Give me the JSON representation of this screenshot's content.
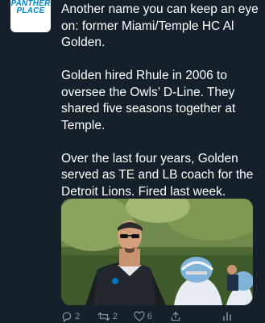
{
  "author": {
    "avatar_logo_text": "PANTHER PLACE"
  },
  "tweet": {
    "paragraphs": [
      "Another name you can keep an eye on: former Miami/Temple HC Al Golden.",
      "Golden hired Rhule in 2006 to oversee the Owls’ D-Line. They shared five seasons together at Temple.",
      "Over the last four years, Golden served as TE and LB coach for the Detroit Lions. Fired last week."
    ]
  },
  "actions": {
    "reply_count": "2",
    "retweet_count": "2",
    "like_count": "6"
  },
  "icons": {
    "reply": "reply-icon",
    "retweet": "retweet-icon",
    "like": "heart-icon",
    "share": "share-icon",
    "analytics": "analytics-icon"
  },
  "colors": {
    "background": "#15202b",
    "text": "#ffffff",
    "muted": "#8899a6",
    "lions_blue": "#0076b6"
  }
}
